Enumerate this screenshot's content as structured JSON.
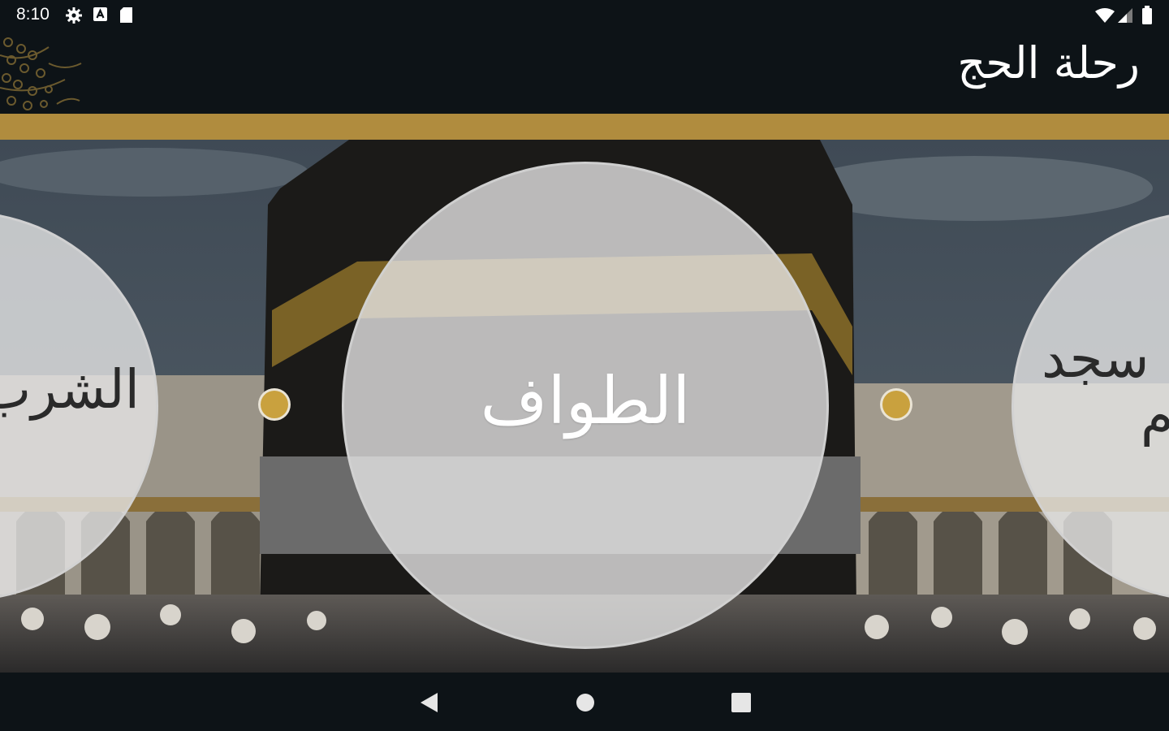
{
  "status_bar": {
    "time": "8:10",
    "left_icons": [
      "settings-icon",
      "notification-a-icon",
      "sd-card-icon"
    ],
    "right_icons": [
      "wifi-icon",
      "cell-signal-icon",
      "battery-icon"
    ]
  },
  "app_bar": {
    "title": "رحلة الحج",
    "background": "#0d1317",
    "accent_bar_color": "#b08c3e"
  },
  "carousel": {
    "items": [
      {
        "label": "الشرب",
        "position": "left"
      },
      {
        "label": "الطواف",
        "position": "center"
      },
      {
        "label_line1": "سجد",
        "label_line2": "م",
        "position": "right"
      }
    ],
    "dot_color": "#c9a13e",
    "background_scene": "kaaba-photo"
  },
  "nav_bar": {
    "buttons": [
      "back-icon",
      "home-icon",
      "recent-apps-icon"
    ]
  }
}
